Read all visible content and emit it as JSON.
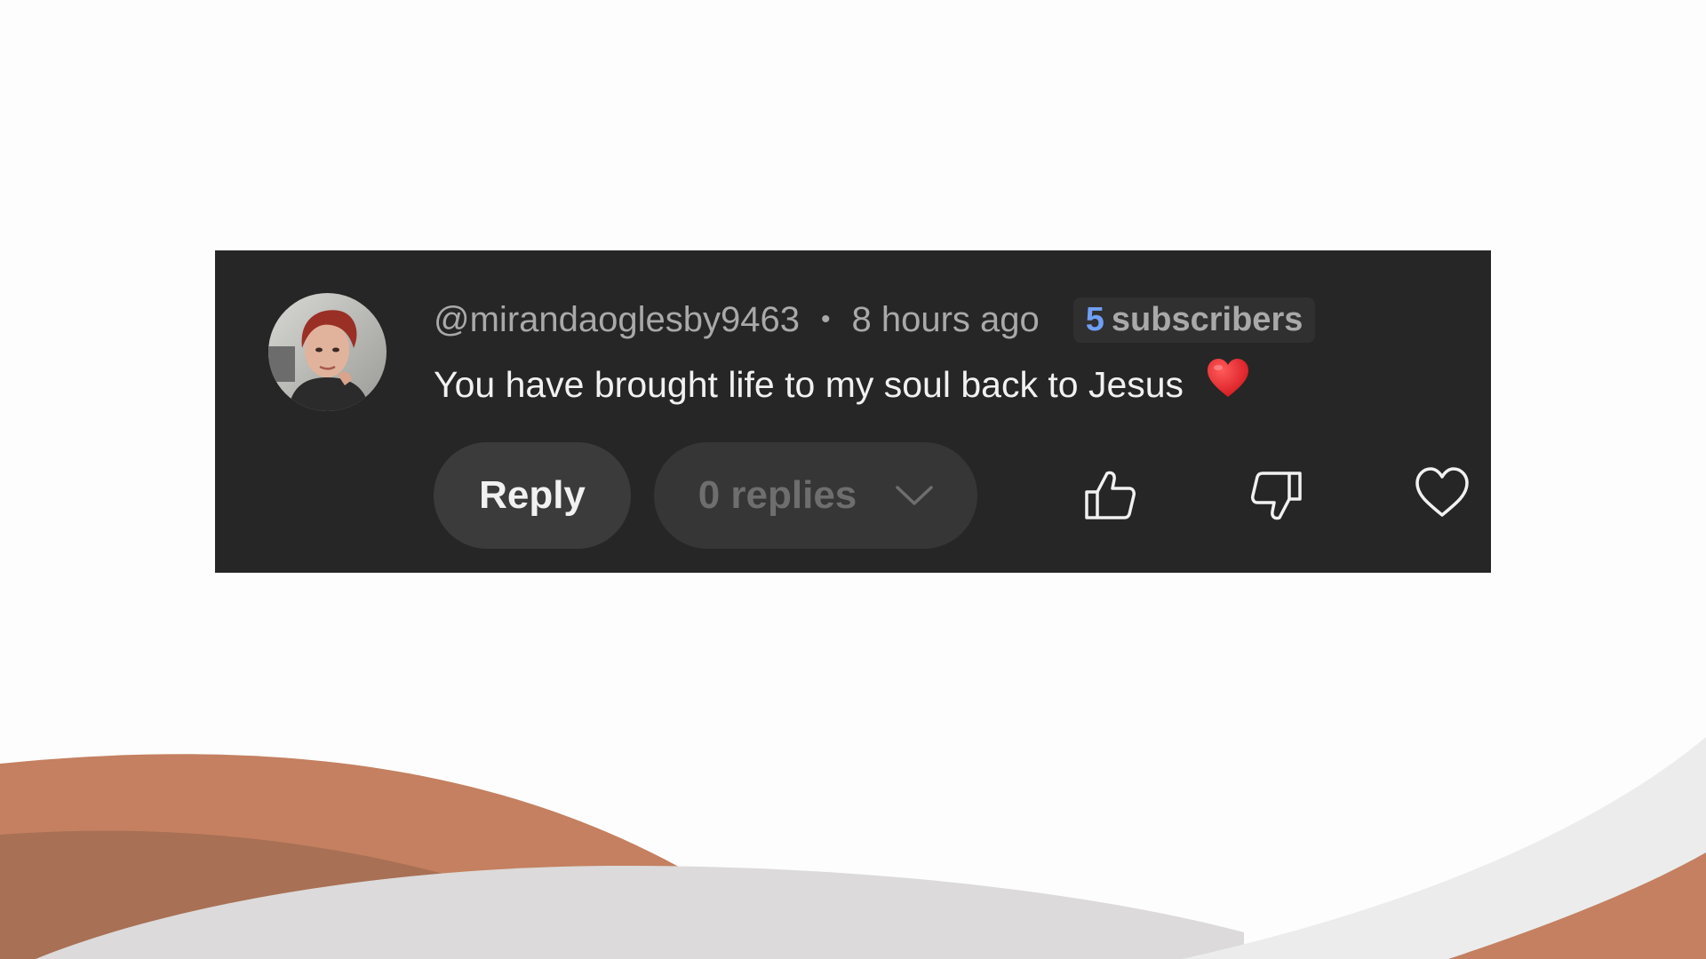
{
  "comment": {
    "author": "@mirandaoglesby9463",
    "separator": "•",
    "time_ago": "8 hours ago",
    "subscribers_count": "5",
    "subscribers_label": "subscribers",
    "text": "You have brought life to my soul back to Jesus",
    "emoji_icon": "red-heart-emoji"
  },
  "actions": {
    "reply_label": "Reply",
    "replies_label": "0 replies",
    "replies_icon": "chevron-down-icon",
    "like_icon": "thumbs-up-icon",
    "dislike_icon": "thumbs-down-icon",
    "heart_icon": "heart-outline-icon"
  },
  "colors": {
    "card_background": "#262626",
    "subscriber_count": "#6f9ff5",
    "wave_orange": "#c48060",
    "wave_dark": "#a87055",
    "wave_gray": "#dcdada"
  }
}
